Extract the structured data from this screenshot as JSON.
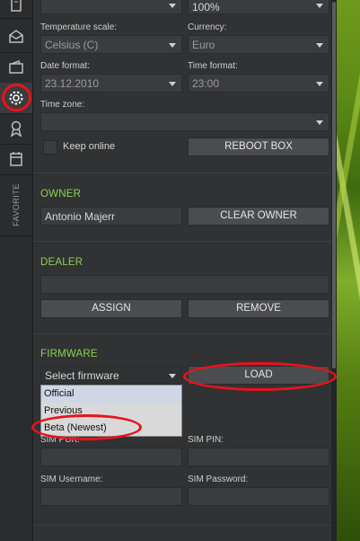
{
  "sidebar": {
    "favorite_label": "FAVORITE"
  },
  "top_row": {
    "left_value": "",
    "right_value": "100%"
  },
  "settings": {
    "temperature_scale_label": "Temperature scale:",
    "temperature_scale_value": "Celsius (C)",
    "currency_label": "Currency:",
    "currency_value": "Euro",
    "date_format_label": "Date format:",
    "date_format_value": "23.12.2010",
    "time_format_label": "Time format:",
    "time_format_value": "23:00",
    "time_zone_label": "Time zone:",
    "time_zone_value": "",
    "keep_online_label": "Keep online",
    "reboot_button": "REBOOT BOX"
  },
  "owner": {
    "heading": "OWNER",
    "name": "Antonio Majerr",
    "clear_button": "CLEAR OWNER"
  },
  "dealer": {
    "heading": "DEALER",
    "value": "",
    "assign_button": "ASSIGN",
    "remove_button": "REMOVE"
  },
  "firmware": {
    "heading": "FIRMWARE",
    "placeholder": "Select firmware",
    "load_button": "LOAD",
    "options": [
      "Official",
      "Previous",
      "Beta (Newest)"
    ]
  },
  "sim": {
    "puk_label_partial": "SIM PUK:",
    "pin_label": "SIM PIN:",
    "username_label": "SIM Username:",
    "password_label": "SIM Password:"
  },
  "colors": {
    "section_heading": "#8fd14f",
    "highlight_ring": "#e8131b"
  }
}
